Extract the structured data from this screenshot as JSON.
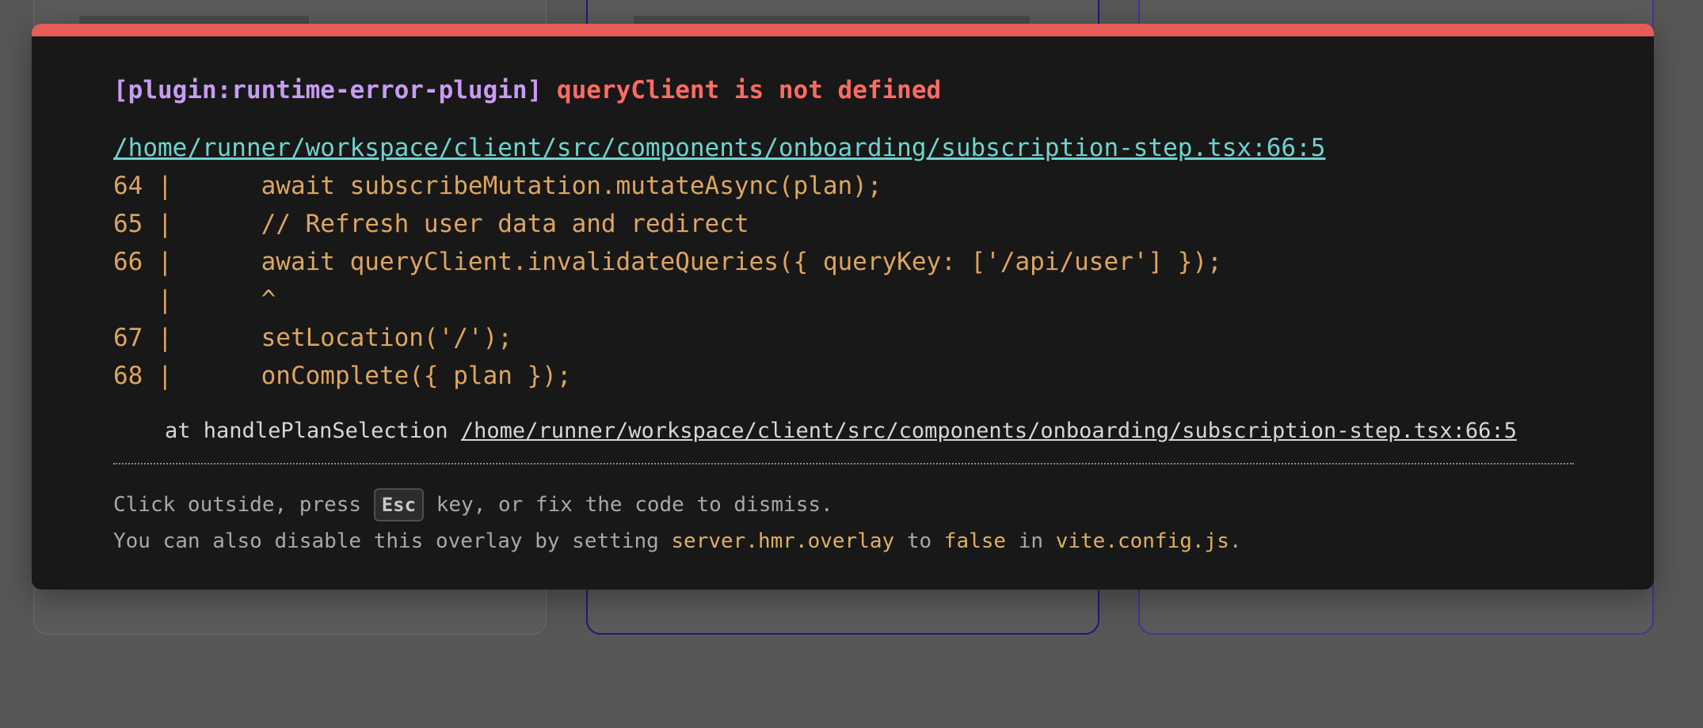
{
  "overlay": {
    "plugin_tag": "[plugin:runtime-error-plugin]",
    "error_message": "queryClient is not defined",
    "file_link": "/home/runner/workspace/client/src/components/onboarding/subscription-step.tsx:66:5",
    "frame_lines": [
      "64 |      await subscribeMutation.mutateAsync(plan);",
      "65 |      // Refresh user data and redirect",
      "66 |      await queryClient.invalidateQueries({ queryKey: ['/api/user'] });",
      "   |      ^",
      "67 |      setLocation('/');",
      "68 |      onComplete({ plan });"
    ],
    "stack_prefix": "    at handlePlanSelection ",
    "stack_link": "/home/runner/workspace/client/src/components/onboarding/subscription-step.tsx:66:5",
    "tip_line1_before": "Click outside, press ",
    "tip_key": "Esc",
    "tip_line1_after": " key, or fix the code to dismiss.",
    "tip_line2_before": "You can also disable this overlay by setting ",
    "tip_setting": "server.hmr.overlay",
    "tip_to": " to ",
    "tip_false": "false",
    "tip_in": " in ",
    "tip_config": "vite.config.js",
    "tip_period": "."
  },
  "colors": {
    "overlay_accent": "#e65c56",
    "plugin_color": "#c79cf2",
    "error_color": "#ff6b62",
    "link_color": "#6fd3ce",
    "code_color": "#dea55e"
  }
}
